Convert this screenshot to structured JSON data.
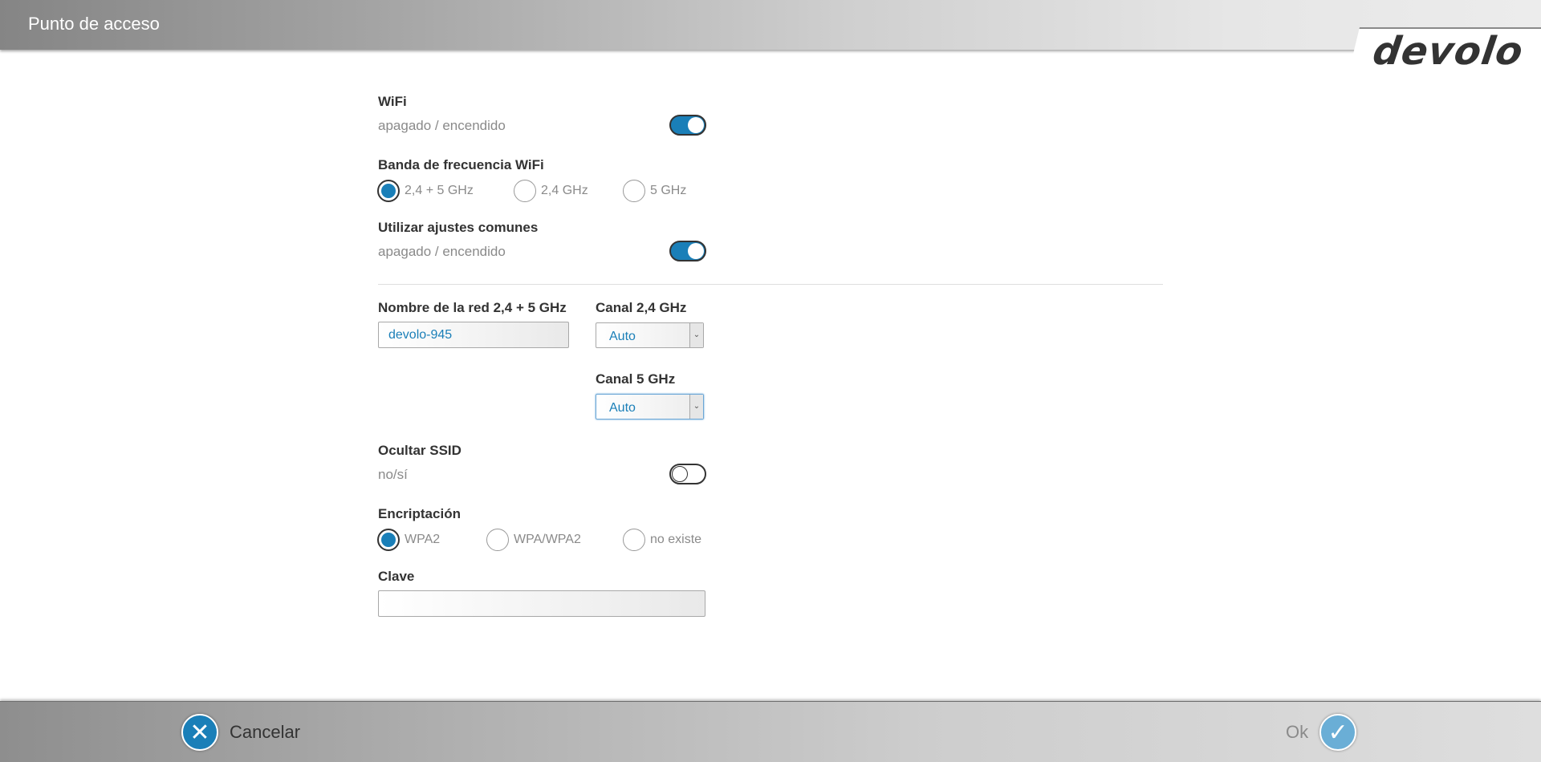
{
  "header": {
    "title": "Punto de acceso",
    "logo": "devolo"
  },
  "wifi": {
    "label": "WiFi",
    "sublabel": "apagado / encendido",
    "on": true
  },
  "band": {
    "label": "Banda de frecuencia WiFi",
    "options": [
      "2,4 + 5 GHz",
      "2,4 GHz",
      "5 GHz"
    ],
    "selected": "2,4 + 5 GHz"
  },
  "common": {
    "label": "Utilizar ajustes comunes",
    "sublabel": "apagado / encendido",
    "on": true
  },
  "network_name": {
    "label": "Nombre de la red 2,4 + 5 GHz",
    "value": "devolo-945"
  },
  "channel_24": {
    "label": "Canal 2,4 GHz",
    "value": "Auto"
  },
  "channel_5": {
    "label": "Canal 5 GHz",
    "value": "Auto"
  },
  "hide_ssid": {
    "label": "Ocultar SSID",
    "sublabel": "no/sí",
    "on": false
  },
  "encryption": {
    "label": "Encriptación",
    "options": [
      "WPA2",
      "WPA/WPA2",
      "no existe"
    ],
    "selected": "WPA2"
  },
  "key": {
    "label": "Clave",
    "value": ""
  },
  "footer": {
    "cancel_label": "Cancelar",
    "ok_label": "Ok"
  },
  "colors": {
    "accent": "#1a7fb8",
    "ok_accent": "#6aaed6"
  },
  "icons": {
    "cancel": "close-icon",
    "ok": "check-icon",
    "select_arrow": "chevron-down-icon"
  }
}
